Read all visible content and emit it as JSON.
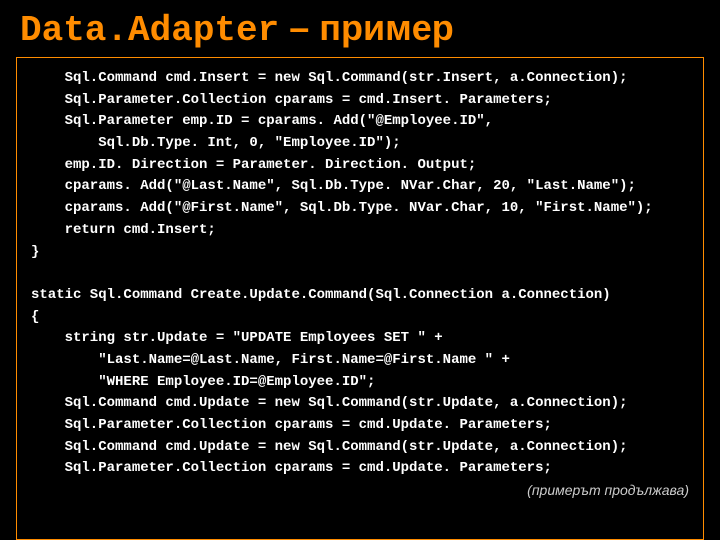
{
  "title": {
    "mono": "Data.Adapter",
    "dash": " – ",
    "cyrillic": "пример"
  },
  "code": {
    "l1": "    Sql.Command cmd.Insert = new Sql.Command(str.Insert, a.Connection);",
    "l2": "    Sql.Parameter.Collection cparams = cmd.Insert. Parameters;",
    "l3": "    Sql.Parameter emp.ID = cparams. Add(\"@Employee.ID\",",
    "l4": "        Sql.Db.Type. Int, 0, \"Employee.ID\");",
    "l5": "    emp.ID. Direction = Parameter. Direction. Output;",
    "l6": "    cparams. Add(\"@Last.Name\", Sql.Db.Type. NVar.Char, 20, \"Last.Name\");",
    "l7": "    cparams. Add(\"@First.Name\", Sql.Db.Type. NVar.Char, 10, \"First.Name\");",
    "l8": "    return cmd.Insert;",
    "l9": "}",
    "l10": "",
    "l11": "static Sql.Command Create.Update.Command(Sql.Connection a.Connection)",
    "l12": "{",
    "l13": "    string str.Update = \"UPDATE Employees SET \" +",
    "l14": "        \"Last.Name=@Last.Name, First.Name=@First.Name \" +",
    "l15": "        \"WHERE Employee.ID=@Employee.ID\";",
    "l16": "    Sql.Command cmd.Update = new Sql.Command(str.Update, a.Connection);",
    "l17": "    Sql.Parameter.Collection cparams = cmd.Update. Parameters;",
    "l18": "    Sql.Command cmd.Update = new Sql.Command(str.Update, a.Connection);",
    "l19": "    Sql.Parameter.Collection cparams = cmd.Update. Parameters;"
  },
  "continuation": "(примерът продължава)"
}
